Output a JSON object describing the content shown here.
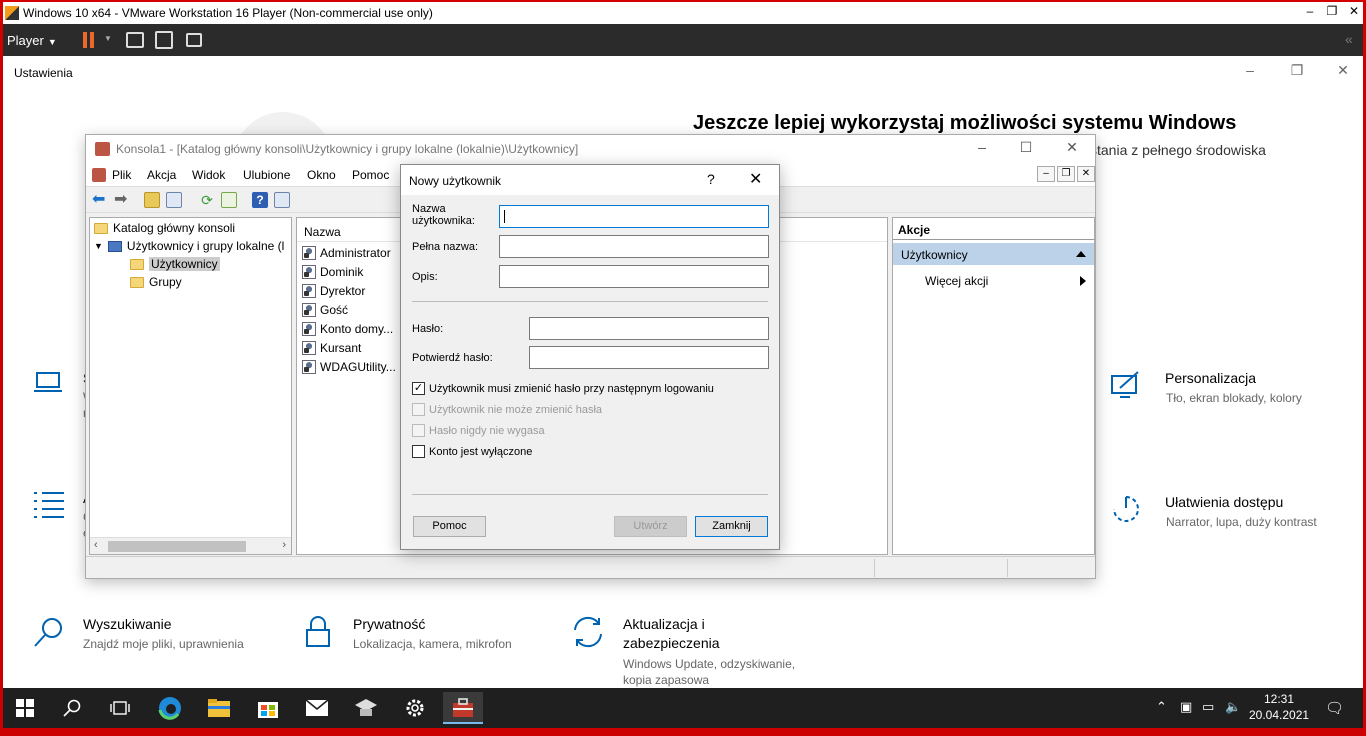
{
  "vmware": {
    "title": "Windows 10 x64 - VMware Workstation 16 Player (Non-commercial use only)",
    "player_menu": "Player",
    "minimize": "–",
    "restore": "❐",
    "close": "✕",
    "collapse": "«"
  },
  "settings": {
    "title": "Ustawienia",
    "promo_title": "Jeszcze lepiej wykorzystaj możliwości systemu Windows",
    "promo_sub": "ystania z pełnego środowiska",
    "tiles": {
      "personalizacja": {
        "title": "Personalizacja",
        "sub": "Tło, ekran blokady, kolory"
      },
      "ulatwienia": {
        "title": "Ułatwienia dostępu",
        "sub": "Narrator, lupa, duży kontrast"
      },
      "wyszukiwanie": {
        "title": "Wyszukiwanie",
        "sub": "Znajdź moje pliki, uprawnienia"
      },
      "prywatnosc": {
        "title": "Prywatność",
        "sub": "Lokalizacja, kamera, mikrofon"
      },
      "aktualizacja": {
        "title": "Aktualizacja i",
        "title2": "zabezpieczenia",
        "sub": "Windows Update, odzyskiwanie,",
        "sub2": "kopia zapasowa"
      }
    },
    "partial_letters": {
      "s": "S",
      "w": "W",
      "n": "n",
      "a": "A",
      "c": "C",
      "ell": "e"
    }
  },
  "mmc": {
    "title": "Konsola1 - [Katalog główny konsoli\\Użytkownicy i grupy lokalne (lokalnie)\\Użytkownicy]",
    "menu": [
      "Plik",
      "Akcja",
      "Widok",
      "Ulubione",
      "Okno",
      "Pomoc"
    ],
    "tree": {
      "root": "Katalog główny konsoli",
      "local": "Użytkownicy i grupy lokalne (l",
      "users": "Użytkownicy",
      "groups": "Grupy"
    },
    "list_header": "Nazwa",
    "users": [
      "Administrator",
      "Dominik",
      "Dyrektor",
      "Gość",
      "Konto domy...",
      "Kursant",
      "WDAGUtility..."
    ],
    "actions": {
      "header": "Akcje",
      "group": "Użytkownicy",
      "more": "Więcej akcji"
    }
  },
  "dialog": {
    "title": "Nowy użytkownik",
    "help": "?",
    "close": "✕",
    "username_label_1": "Nazwa",
    "username_label_2": "użytkownika:",
    "username_value": "",
    "fullname_label": "Pełna nazwa:",
    "fullname_value": "",
    "desc_label": "Opis:",
    "desc_value": "",
    "password_label": "Hasło:",
    "confirm_label": "Potwierdź hasło:",
    "checkboxes": {
      "must_change": {
        "label": "Użytkownik musi zmienić hasło przy następnym logowaniu",
        "checked": true
      },
      "cannot_change": {
        "label": "Użytkownik nie może zmienić hasła",
        "checked": false
      },
      "never_expires": {
        "label": "Hasło nigdy nie wygasa",
        "checked": false
      },
      "disabled": {
        "label": "Konto jest wyłączone",
        "checked": false
      }
    },
    "buttons": {
      "help": "Pomoc",
      "create": "Utwórz",
      "close": "Zamknij"
    },
    "check_mark": "✓"
  },
  "taskbar": {
    "start_icon": "windows-start-icon",
    "clock_time": "12:31",
    "clock_date": "20.04.2021"
  },
  "colors": {
    "accent": "#0078d7",
    "vm_border": "#d40000",
    "selection": "#bcd2e8"
  }
}
